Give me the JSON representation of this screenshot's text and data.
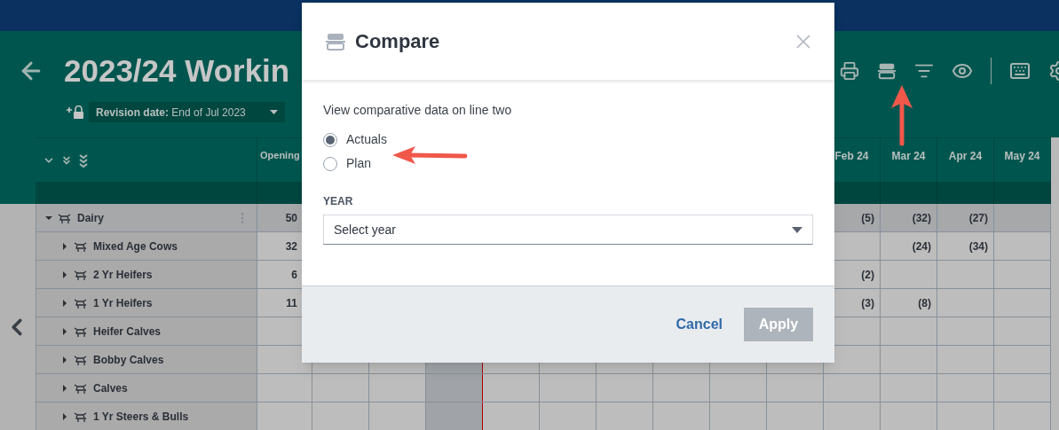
{
  "header": {
    "title": "2023/24 Workin",
    "revision": "**Revision date:** End of Jul 2023"
  },
  "table": {
    "columns": [
      "Opening",
      "Feb 24",
      "Mar 24",
      "Apr 24",
      "May 24"
    ],
    "rows": [
      {
        "name": "Dairy",
        "expanded": true,
        "values": {
          "column_1": "50",
          "column_2": "(5)",
          "column_3": "(32)",
          "column_4": "(27)"
        },
        "children": [
          {
            "name": "Mixed Age Cows",
            "expanded": false,
            "values": {
              "column_1": "32",
              "column_3": "(24)",
              "column_4": "(34)"
            }
          },
          {
            "name": "2 Yr Heifers",
            "expanded": false,
            "values": {
              "column_1": "6",
              "column_2": "(2)"
            }
          },
          {
            "name": "1 Yr Heifers",
            "expanded": false,
            "values": {
              "column_1": "11",
              "column_2": "(3)",
              "column_3": "(8)"
            }
          },
          {
            "name": "Heifer Calves",
            "expanded": false
          },
          {
            "name": "Bobby Calves",
            "expanded": false
          },
          {
            "name": "Calves",
            "expanded": false
          },
          {
            "name": "1 Yr Steers & Bulls",
            "expanded": false
          }
        ]
      }
    ]
  },
  "dialog": {
    "title": "Compare",
    "prompt": "View comparative data on line two",
    "options": [
      {
        "label": "Actuals",
        "selected": true
      },
      {
        "label": "Plan",
        "selected": false
      }
    ],
    "year_label": "YEAR",
    "year_placeholder": "Select year",
    "cancel": "Cancel",
    "apply": {
      "label": "Apply",
      "disabled": true
    }
  }
}
